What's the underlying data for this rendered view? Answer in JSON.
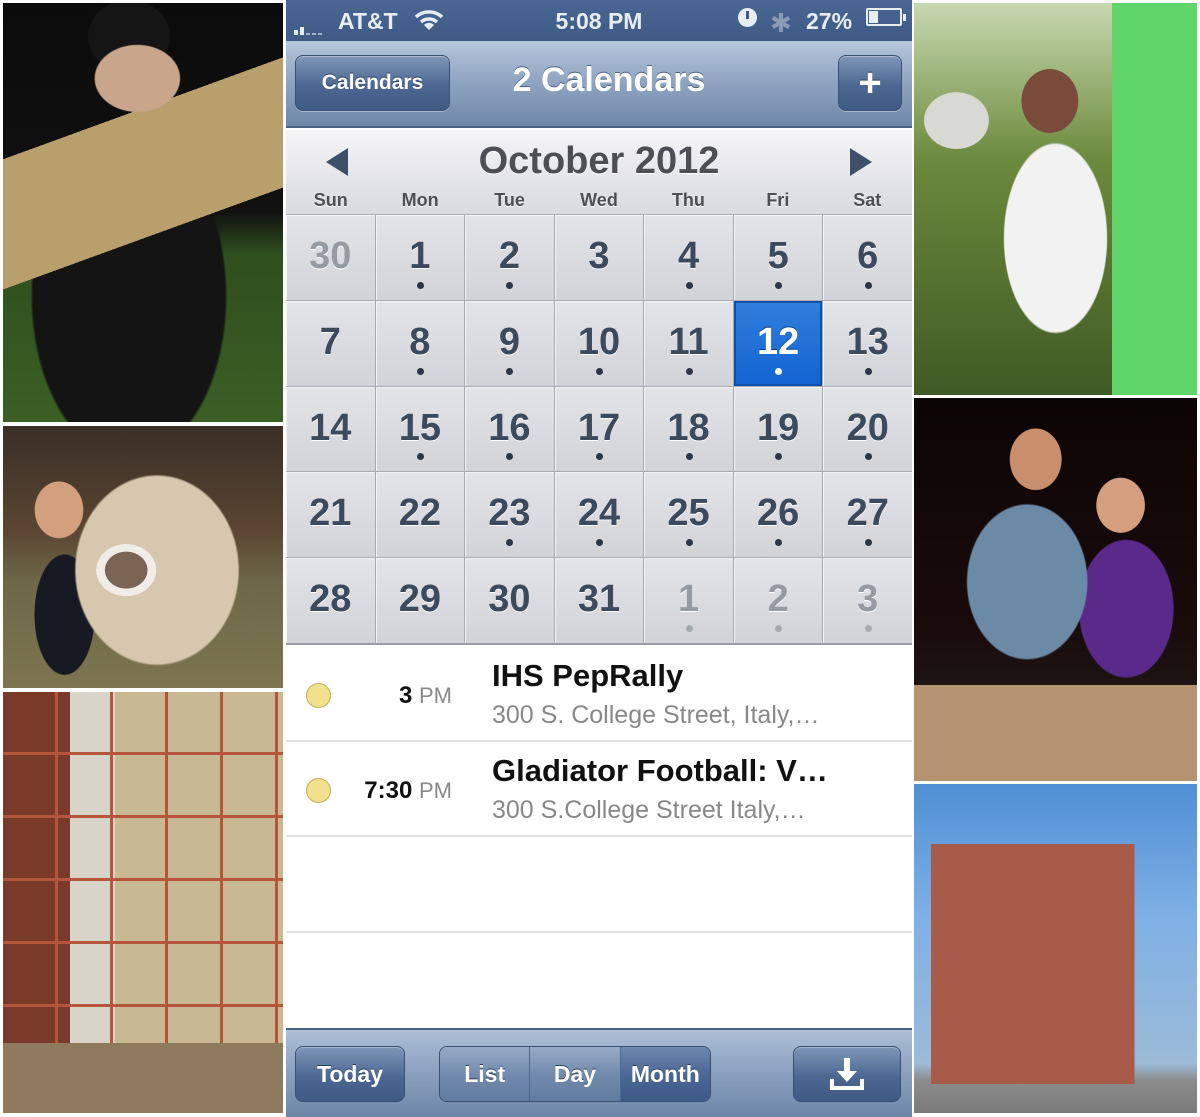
{
  "collage": {
    "left_photos": [
      {
        "id": "p-l1",
        "name": "photo-band-member",
        "description": "Marching band member in uniform holding a bass clarinet at night"
      },
      {
        "id": "p-l2",
        "name": "photo-girl-teddy-bear",
        "description": "Smiling girl hugging a giant teddy bear"
      },
      {
        "id": "p-l3",
        "name": "photo-building-scaffolding",
        "description": "Workers on scaffolding renovating a building facade"
      }
    ],
    "right_photos": [
      {
        "id": "p-r1",
        "name": "photo-picnic-people",
        "description": "People talking outdoors near lawn chairs"
      },
      {
        "id": "p-r2",
        "name": "photo-couple-hotdogs",
        "description": "Man and woman posing at night holding hot dogs"
      },
      {
        "id": "p-r3",
        "name": "photo-bank-building-flags",
        "description": "Historic brick building with US and Texas flags"
      }
    ]
  },
  "status_bar": {
    "carrier": "AT&T",
    "time": "5:08 PM",
    "battery_percent_label": "27%",
    "battery_level": 0.27,
    "icons": [
      "signal-icon",
      "wifi-icon",
      "alarm-icon",
      "bluetooth-icon",
      "battery-icon"
    ]
  },
  "nav_bar": {
    "left_button": "Calendars",
    "title": "2 Calendars",
    "right_button": "+"
  },
  "calendar": {
    "month_title": "October 2012",
    "weekdays": [
      "Sun",
      "Mon",
      "Tue",
      "Wed",
      "Thu",
      "Fri",
      "Sat"
    ],
    "selected_day": 12,
    "weeks": [
      [
        {
          "d": "30",
          "other": true,
          "dot": false
        },
        {
          "d": "1",
          "dot": true
        },
        {
          "d": "2",
          "dot": true
        },
        {
          "d": "3",
          "dot": false
        },
        {
          "d": "4",
          "dot": true
        },
        {
          "d": "5",
          "dot": true
        },
        {
          "d": "6",
          "dot": true
        }
      ],
      [
        {
          "d": "7",
          "dot": false
        },
        {
          "d": "8",
          "dot": true
        },
        {
          "d": "9",
          "dot": true
        },
        {
          "d": "10",
          "dot": true
        },
        {
          "d": "11",
          "dot": true
        },
        {
          "d": "12",
          "dot": true,
          "selected": true
        },
        {
          "d": "13",
          "dot": true
        }
      ],
      [
        {
          "d": "14",
          "dot": false
        },
        {
          "d": "15",
          "dot": true
        },
        {
          "d": "16",
          "dot": true
        },
        {
          "d": "17",
          "dot": true
        },
        {
          "d": "18",
          "dot": true
        },
        {
          "d": "19",
          "dot": true
        },
        {
          "d": "20",
          "dot": true
        }
      ],
      [
        {
          "d": "21",
          "dot": false
        },
        {
          "d": "22",
          "dot": false
        },
        {
          "d": "23",
          "dot": true
        },
        {
          "d": "24",
          "dot": true
        },
        {
          "d": "25",
          "dot": true
        },
        {
          "d": "26",
          "dot": true
        },
        {
          "d": "27",
          "dot": true
        }
      ],
      [
        {
          "d": "28",
          "dot": false
        },
        {
          "d": "29",
          "dot": false
        },
        {
          "d": "30",
          "dot": false
        },
        {
          "d": "31",
          "dot": false
        },
        {
          "d": "1",
          "other": true,
          "dot": true
        },
        {
          "d": "2",
          "other": true,
          "dot": true
        },
        {
          "d": "3",
          "other": true,
          "dot": true
        }
      ]
    ]
  },
  "events": [
    {
      "time": "3",
      "ampm": "PM",
      "title": "IHS PepRally",
      "location": "300 S. College Street, Italy,…",
      "calendar_color": "#f1e08e"
    },
    {
      "time": "7:30",
      "ampm": "PM",
      "title": "Gladiator Football: V…",
      "location": "300 S.College Street Italy,…",
      "calendar_color": "#f1e08e"
    }
  ],
  "toolbar": {
    "today": "Today",
    "segments": [
      "List",
      "Day",
      "Month"
    ],
    "active_segment": "Month",
    "inbox_icon": "inbox-download-icon"
  },
  "colors": {
    "bar_blue": "#3e5a85",
    "selected_day": "#1363d3",
    "day_number": "#3b4a5d"
  }
}
